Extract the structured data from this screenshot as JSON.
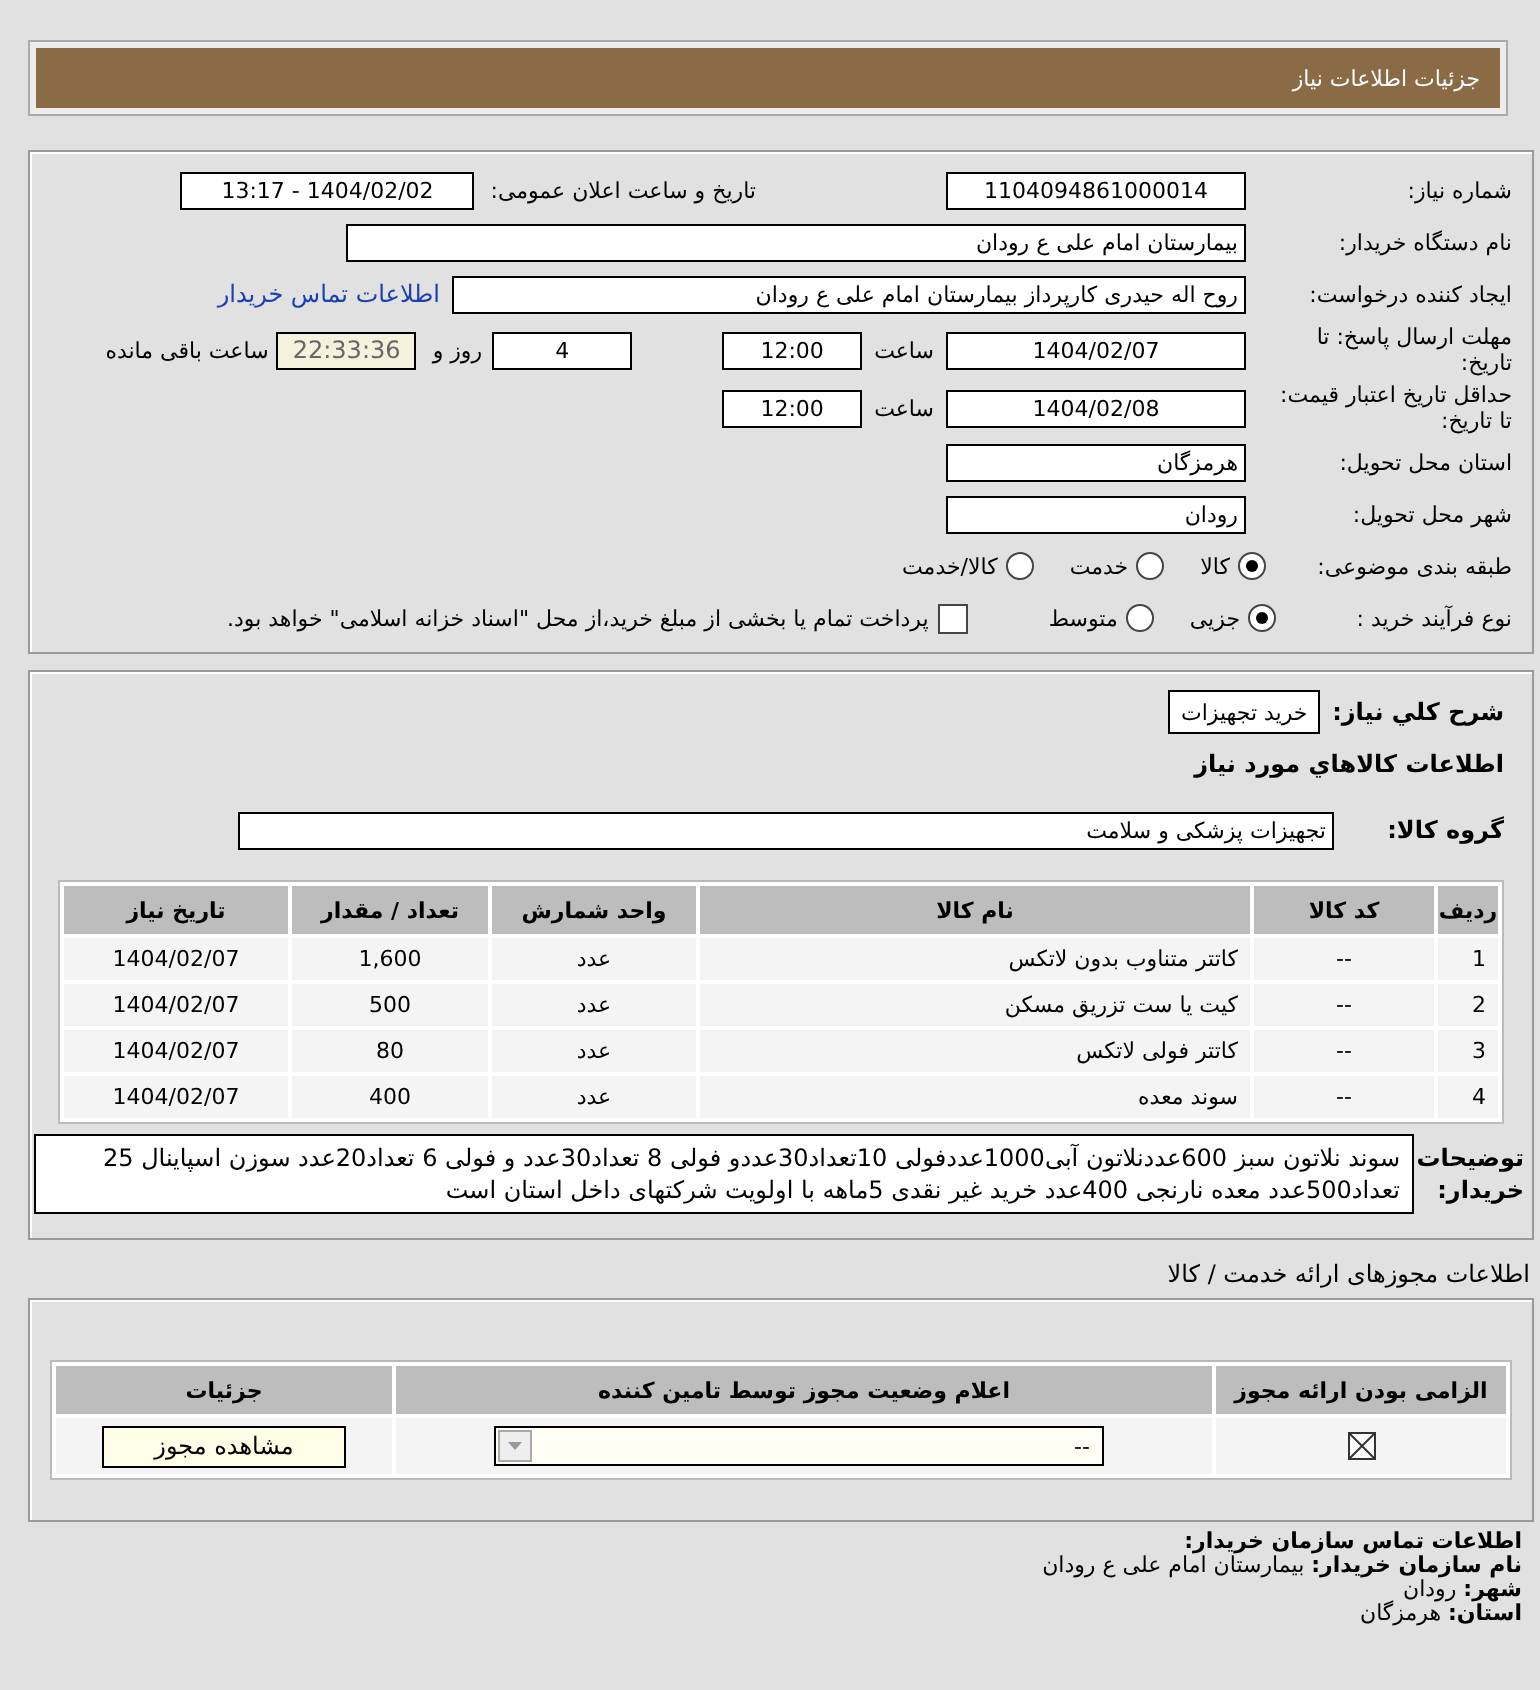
{
  "header": {
    "title": "جزئیات اطلاعات نیاز"
  },
  "need": {
    "number_label": "شماره نیاز:",
    "number": "1104094861000014",
    "announce_label": "تاریخ و ساعت اعلان عمومی:",
    "announce": "1404/02/02 - 13:17",
    "buyer_label": "نام دستگاه خریدار:",
    "buyer": "بیمارستان امام علی  ع  رودان",
    "creator_label": "ایجاد کننده درخواست:",
    "creator": "روح اله حیدری کارپرداز  بیمارستان امام علی  ع  رودان",
    "contact_link": "اطلاعات تماس خریدار",
    "deadline": {
      "label": "مهلت ارسال پاسخ: تا تاریخ:",
      "date": "1404/02/07",
      "time_label": "ساعت",
      "time": "12:00",
      "days": "4",
      "days_label": "روز و",
      "remaining": "22:33:36",
      "remaining_label": "ساعت باقی مانده"
    },
    "validity": {
      "label": "حداقل تاریخ اعتبار قیمت: تا تاریخ:",
      "date": "1404/02/08",
      "time_label": "ساعت",
      "time": "12:00"
    },
    "province_label": "استان محل تحویل:",
    "province": "هرمزگان",
    "city_label": "شهر محل تحویل:",
    "city": "رودان",
    "category": {
      "label": "طبقه بندی موضوعی:",
      "options": [
        {
          "label": "کالا",
          "selected": true
        },
        {
          "label": "خدمت",
          "selected": false
        },
        {
          "label": "کالا/خدمت",
          "selected": false
        }
      ]
    },
    "process": {
      "label": "نوع فرآیند خرید :",
      "options": [
        {
          "label": "جزیی",
          "selected": true
        },
        {
          "label": "متوسط",
          "selected": false
        }
      ],
      "payment": {
        "label": "پرداخت تمام یا بخشی از مبلغ خرید،از محل \"اسناد خزانه اسلامی\" خواهد بود.",
        "checked": false
      }
    }
  },
  "goods": {
    "summary_label": "شرح کلي نياز:",
    "summary": "خرید تجهیزات",
    "section_title": "اطلاعات کالاهاي مورد نياز",
    "group_label": "گروه کالا:",
    "group": "تجهیزات پزشکی و سلامت",
    "columns": [
      "ردیف",
      "کد کالا",
      "نام کالا",
      "واحد شمارش",
      "تعداد / مقدار",
      "تاریخ نیاز"
    ],
    "rows": [
      [
        "1",
        "--",
        "کاتتر متناوب بدون لاتکس",
        "عدد",
        "1,600",
        "1404/02/07"
      ],
      [
        "2",
        "--",
        "کیت یا ست تزریق مسکن",
        "عدد",
        "500",
        "1404/02/07"
      ],
      [
        "3",
        "--",
        "کاتتر فولی لاتکس",
        "عدد",
        "80",
        "1404/02/07"
      ],
      [
        "4",
        "--",
        "سوند معده",
        "عدد",
        "400",
        "1404/02/07"
      ]
    ],
    "notes_label": "توضیحات خریدار:",
    "notes": "سوند نلاتون سبز 600عددنلاتون آبی1000عددفولی 10تعداد30عددو فولی 8 تعداد30عدد و فولی 6 تعداد20عدد سوزن اسپاینال 25 تعداد500عدد معده نارنجی 400عدد خرید غیر نقدی 5ماهه با اولویت شرکتهای داخل استان است"
  },
  "permits": {
    "title": "اطلاعات مجوزهای ارائه خدمت / کالا",
    "columns": [
      "الزامی بودن ارائه مجوز",
      "اعلام وضعیت مجوز توسط تامین کننده",
      "جزئیات"
    ],
    "rows": [
      {
        "required": true,
        "status": "--",
        "action": "مشاهده مجوز"
      }
    ]
  },
  "contact": {
    "title": "اطلاعات تماس سازمان خریدار:",
    "lines": [
      {
        "label": "نام سازمان خریدار:",
        "value": "بیمارستان امام علی ع رودان"
      },
      {
        "label": "شهر:",
        "value": "رودان"
      },
      {
        "label": "استان:",
        "value": "هرمزگان"
      }
    ]
  }
}
